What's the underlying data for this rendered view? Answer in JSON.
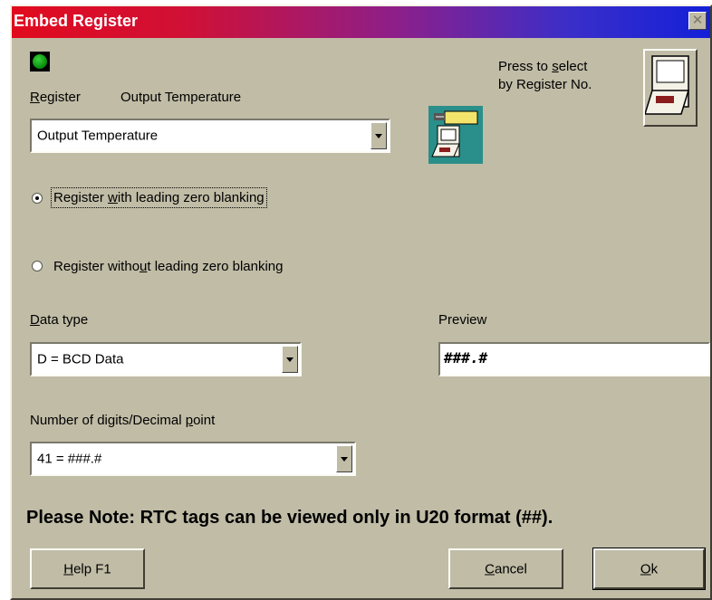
{
  "window": {
    "title": "Embed Register",
    "close_glyph": "✕"
  },
  "register": {
    "label_prefix": "R",
    "label_rest": "egister",
    "current_name": "Output Temperature",
    "selected": "Output Temperature"
  },
  "select_hint": {
    "line1_pre": "Press to ",
    "line1_u": "s",
    "line1_post": "elect",
    "line2": "by Register No."
  },
  "radios": {
    "opt1_pre": "Register ",
    "opt1_u": "w",
    "opt1_post": "ith leading zero blanking",
    "opt2_pre": "Register witho",
    "opt2_u": "u",
    "opt2_post": "t leading zero blanking"
  },
  "data_type": {
    "label_u": "D",
    "label_rest": "ata type",
    "selected": "D = BCD Data"
  },
  "preview": {
    "label": "Preview",
    "value": "###.#"
  },
  "digits": {
    "label_pre": "Number of digits/Decimal ",
    "label_u": "p",
    "label_post": "oint",
    "selected": "41 = ###.#"
  },
  "note": "Please Note: RTC tags can be viewed only in U20 format (##).",
  "buttons": {
    "help_u": "H",
    "help_rest": "elp  F1",
    "cancel_u": "C",
    "cancel_rest": "ancel",
    "ok_u": "O",
    "ok_rest": "k"
  },
  "colors": {
    "dialog_bg": "#c0bca6",
    "title_start": "#e10b1e",
    "title_end": "#1420d8",
    "led": "#0f9a16",
    "icon_teal": "#2a8f8a"
  },
  "icons": [
    "status-led-icon",
    "select-register-icon",
    "register-device-icon",
    "close-icon",
    "dropdown-arrow-icon"
  ]
}
